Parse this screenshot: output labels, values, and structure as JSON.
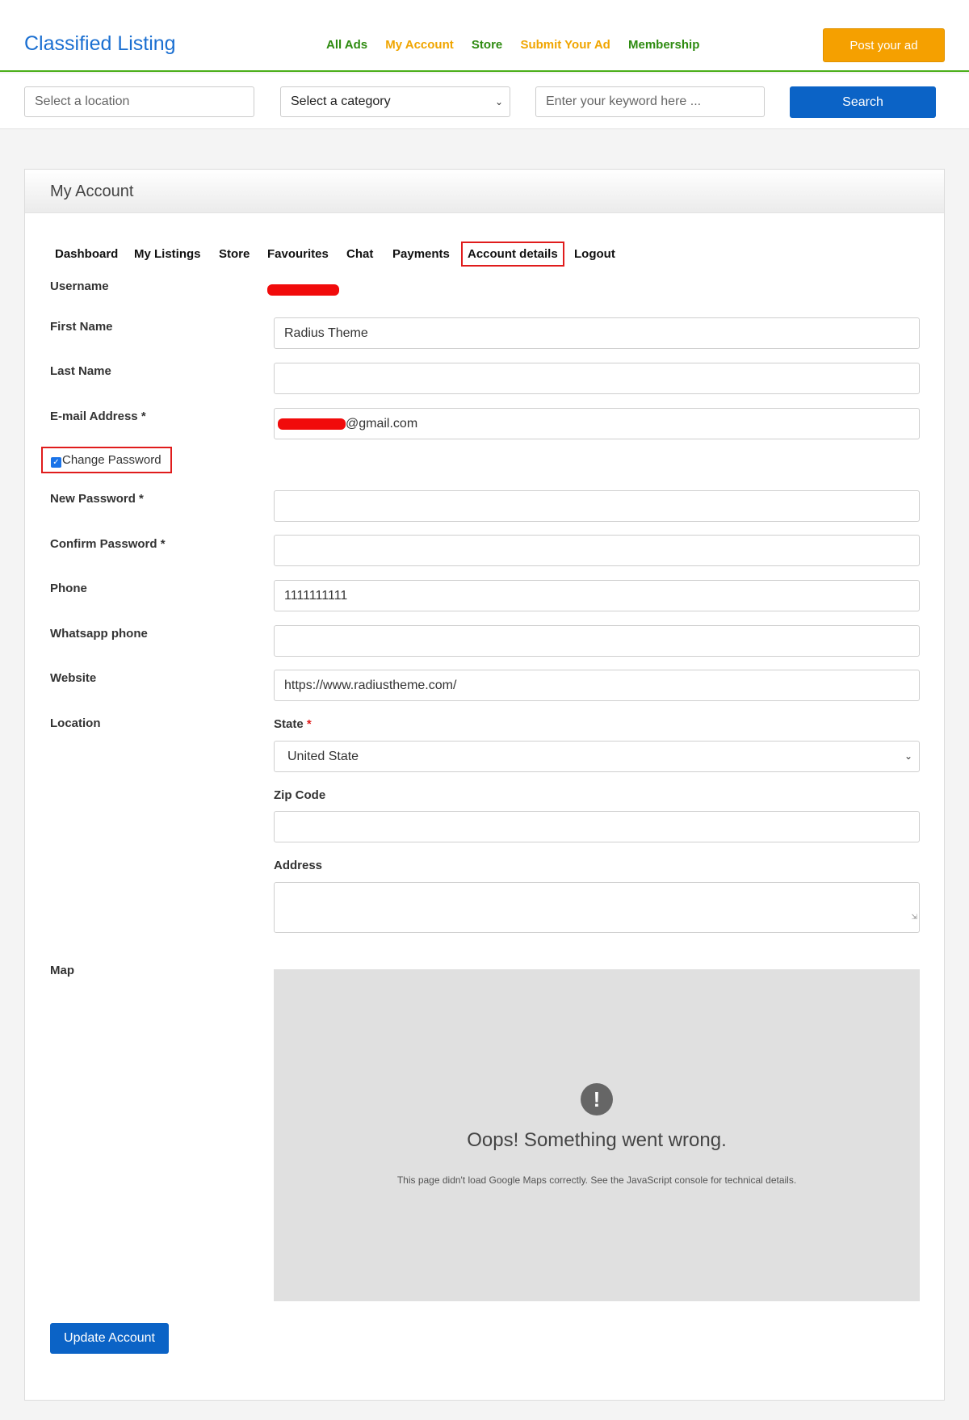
{
  "header": {
    "logo": "Classified Listing",
    "nav": [
      "All Ads",
      "My Account",
      "Store",
      "Submit Your Ad",
      "Membership"
    ],
    "post_button": "Post your ad"
  },
  "search": {
    "location_placeholder": "Select a location",
    "category_selected": "Select a category",
    "keyword_placeholder": "Enter your keyword here ...",
    "button": "Search"
  },
  "account": {
    "title": "My Account",
    "tabs": [
      "Dashboard",
      "My Listings",
      "Store",
      "Favourites",
      "Chat",
      "Payments",
      "Account details",
      "Logout"
    ],
    "labels": {
      "username": "Username",
      "first_name": "First Name",
      "last_name": "Last Name",
      "email": "E-mail Address *",
      "change_password": "Change Password",
      "new_password": "New Password *",
      "confirm_password": "Confirm Password *",
      "phone": "Phone",
      "whatsapp": "Whatsapp phone",
      "website": "Website",
      "location": "Location",
      "state": "State",
      "state_required": "*",
      "zip": "Zip Code",
      "address": "Address",
      "map": "Map"
    },
    "values": {
      "first_name": "Radius Theme",
      "email_suffix": "@gmail.com",
      "phone": "1111111111",
      "website": "https://www.radiustheme.com/",
      "state": "United State"
    },
    "map_error": {
      "icon": "!",
      "title": "Oops! Something went wrong.",
      "description": "This page didn't load Google Maps correctly. See the JavaScript console for technical details."
    },
    "update_button": "Update Account"
  },
  "colors": {
    "brand_blue": "#1a6fd1",
    "button_blue": "#0b63c6",
    "nav_green": "#2e8b10",
    "nav_orange": "#f0a500",
    "post_orange": "#f5a000",
    "highlight_red": "#e01c1c"
  }
}
